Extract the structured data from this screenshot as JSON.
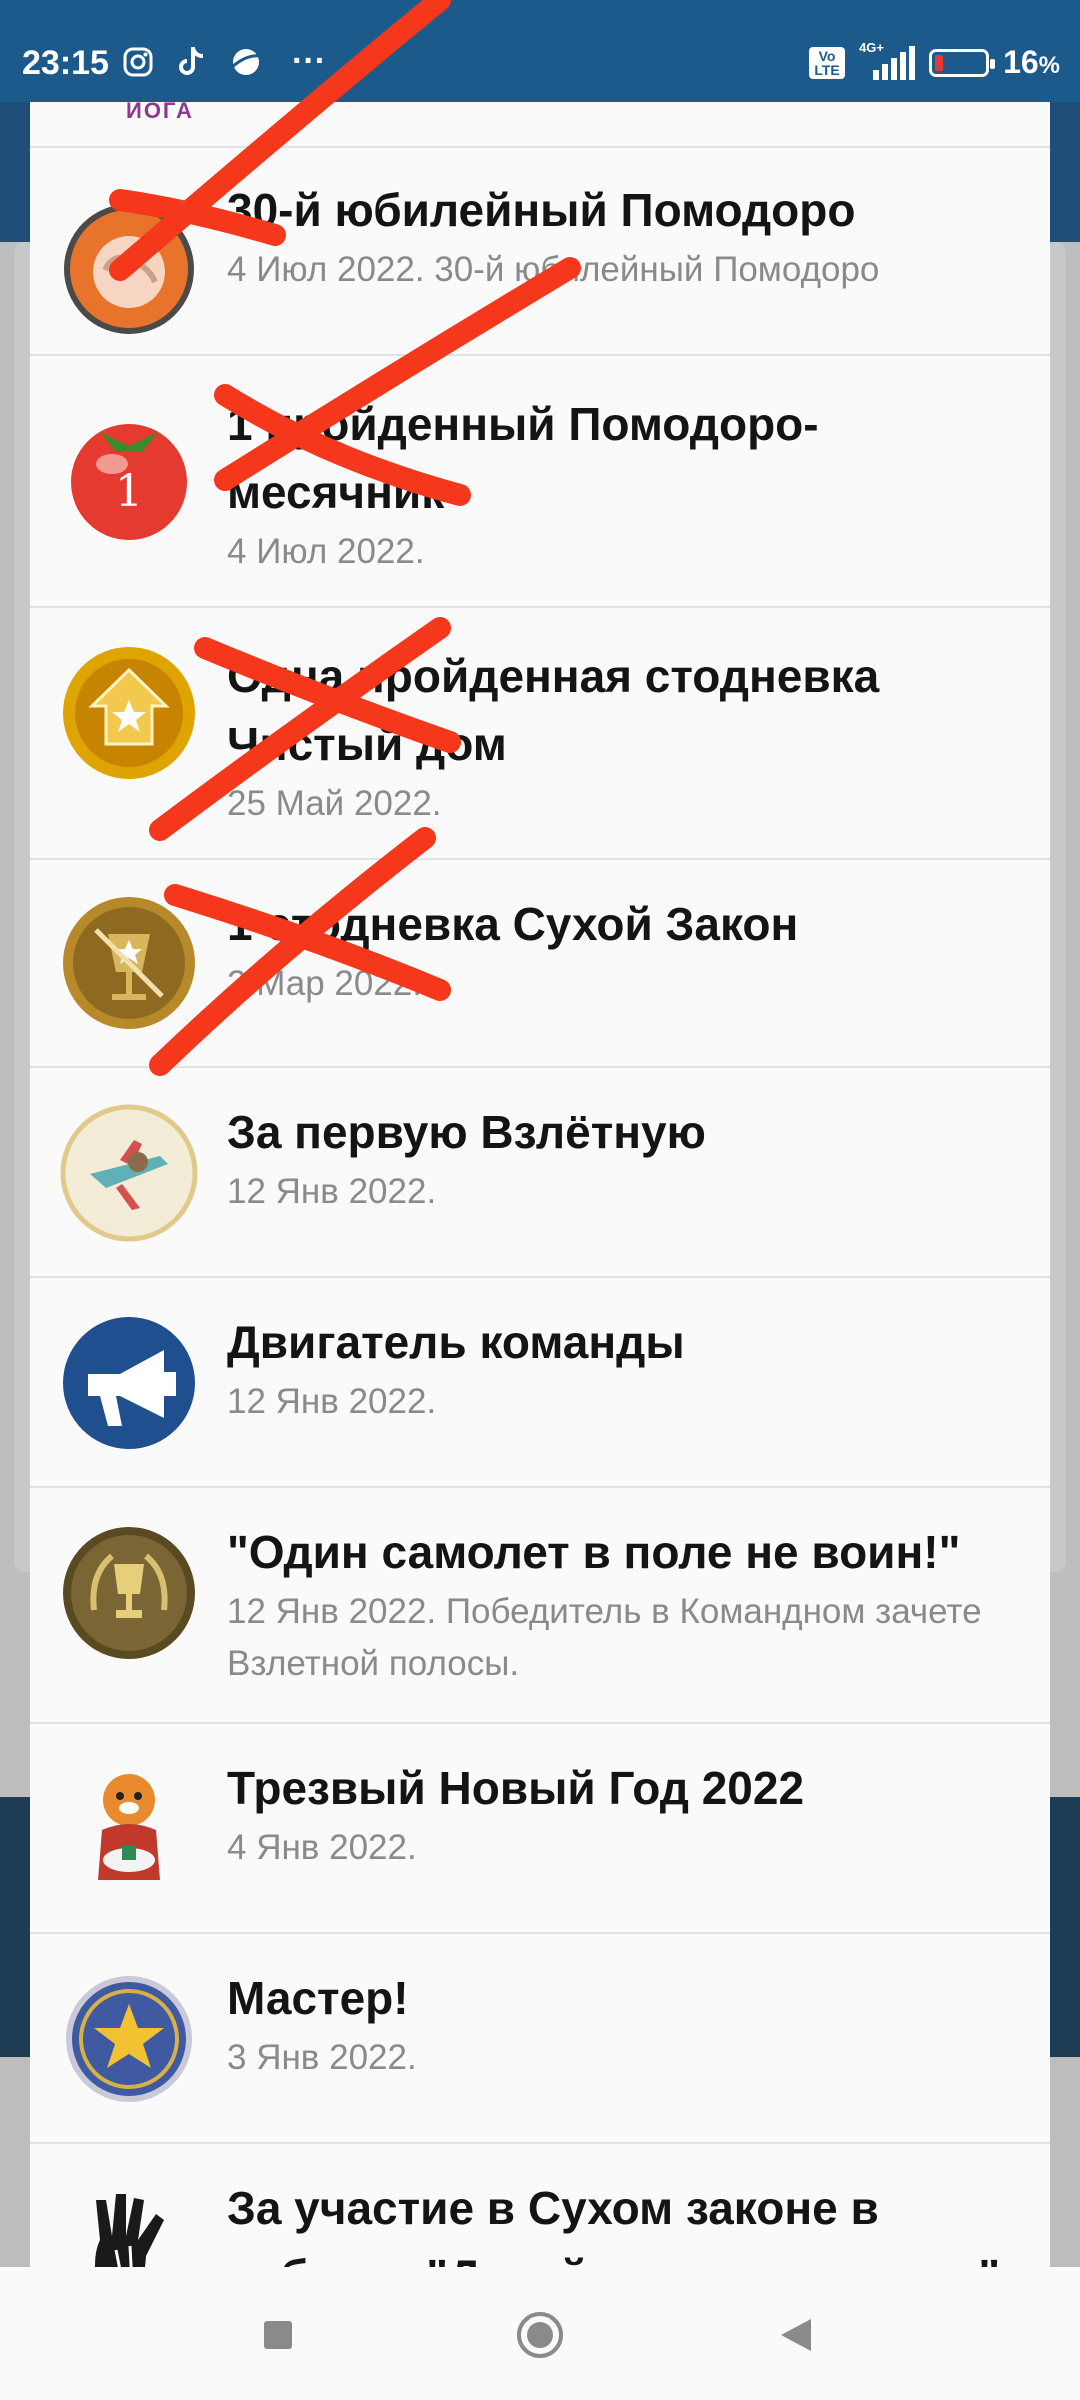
{
  "status_bar": {
    "time": "23:15",
    "battery": "16",
    "battery_unit": "%",
    "network": "4G+",
    "volte": "Vo LTE",
    "more": "···",
    "icons": [
      "instagram-icon",
      "tiktok-icon",
      "planet-icon"
    ]
  },
  "dialog": {
    "top_partial_label": "ЙОГА",
    "items": [
      {
        "title": "30-й юбилейный Помодоро",
        "subtitle": "4 Июл 2022. 30-й юбилейный Помодоро",
        "icon": "tomato-hand-icon",
        "crossed": true
      },
      {
        "title": "1 пройденный Помодоро-месячник",
        "subtitle": "4 Июл 2022.",
        "icon": "tomato-one-icon",
        "crossed": true
      },
      {
        "title": "Одна пройденная стодневка Чистый дом",
        "subtitle": "25 Май 2022.",
        "icon": "house-star-badge-icon",
        "crossed": true
      },
      {
        "title": "1 стодневка Сухой Закон",
        "subtitle": "2 Мар 2022.",
        "icon": "no-alcohol-badge-icon",
        "crossed": true
      },
      {
        "title": "За первую Взлётную",
        "subtitle": "12 Янв 2022.",
        "icon": "airplane-badge-icon",
        "crossed": false
      },
      {
        "title": "Двигатель команды",
        "subtitle": "12 Янв 2022.",
        "icon": "megaphone-badge-icon",
        "crossed": false
      },
      {
        "title": "\"Один самолет в поле не воин!\"",
        "subtitle": "12 Янв 2022. Победитель в Командном зачете Взлетной полосы.",
        "icon": "trophy-badge-icon",
        "crossed": false
      },
      {
        "title": "Трезвый Новый Год 2022",
        "subtitle": "4 Янв 2022.",
        "icon": "tiger-icon",
        "crossed": false
      },
      {
        "title": "Мастер!",
        "subtitle": "3 Янв 2022.",
        "icon": "star-badge-icon",
        "crossed": false
      },
      {
        "title": "За участие в Сухом законе в рубрике \"Давайте познакомимся\"",
        "subtitle": "",
        "icon": "hand-print-icon",
        "crossed": false
      }
    ]
  },
  "nav_bar": {
    "icons": [
      "recents-square-icon",
      "home-circle-icon",
      "back-triangle-icon"
    ]
  },
  "colors": {
    "status_bar": "#1d5a8c",
    "strike": "#f5371c"
  }
}
